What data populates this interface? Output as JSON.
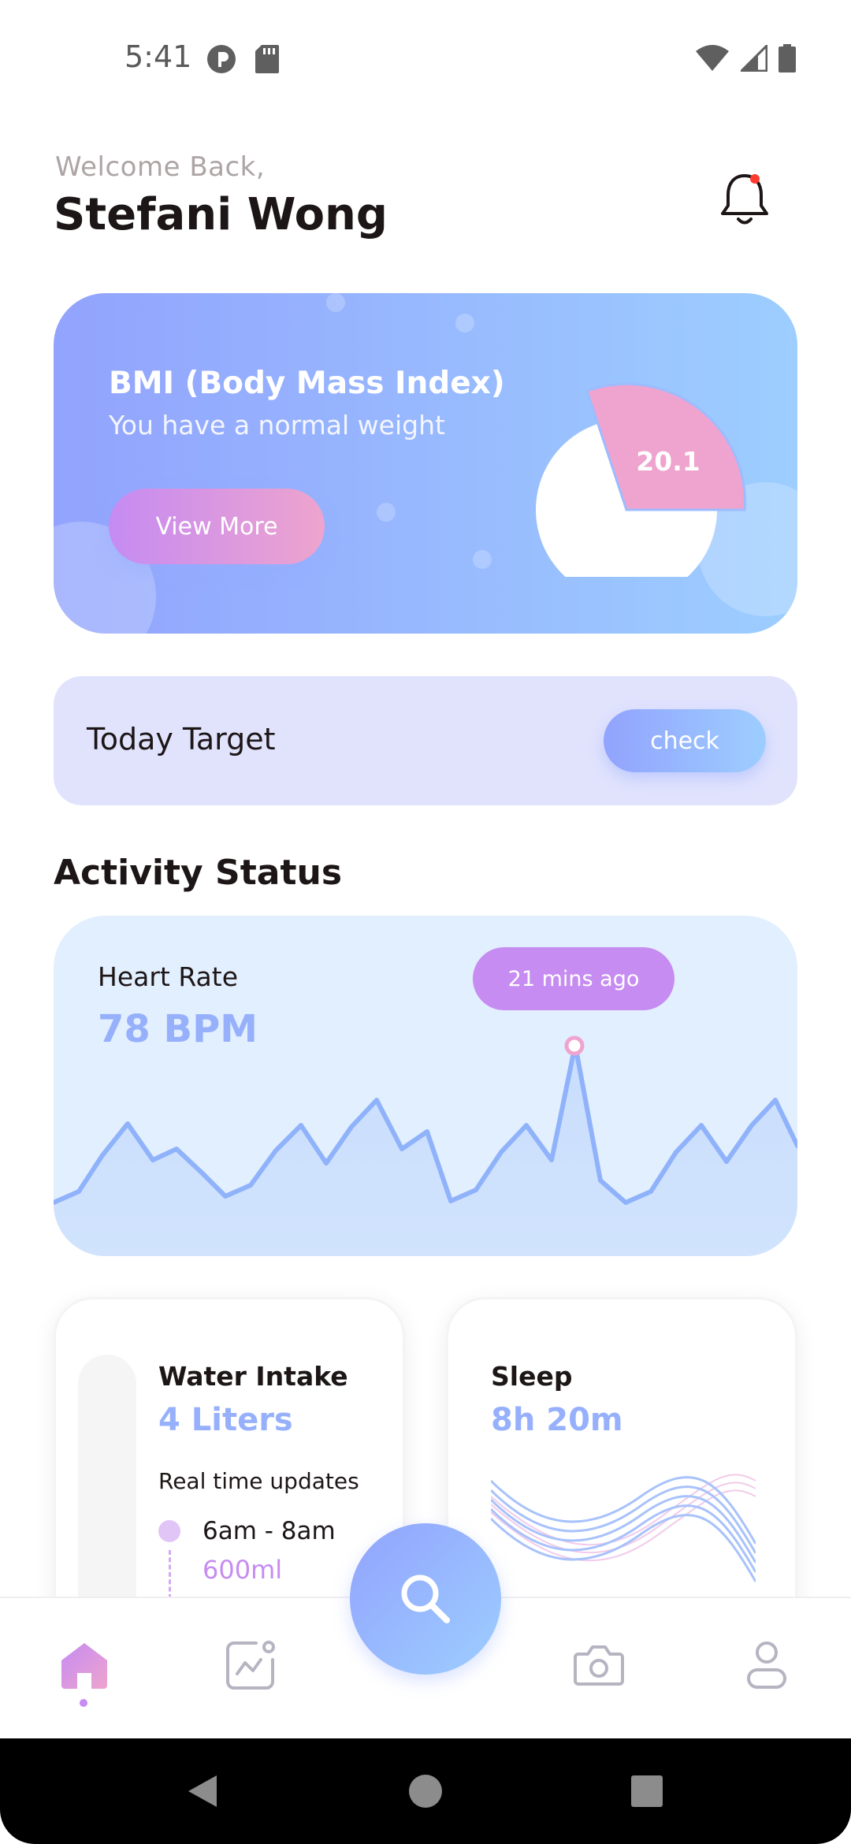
{
  "status_bar": {
    "time": "5:41",
    "left_icons": [
      "notification-app-icon",
      "sd-card-icon"
    ],
    "right_icons": [
      "wifi-icon",
      "cell-signal-icon",
      "battery-icon"
    ]
  },
  "header": {
    "welcome": "Welcome Back,",
    "user_name": "Stefani Wong",
    "notification_icon": "bell-icon",
    "has_unread": true
  },
  "bmi_card": {
    "title": "BMI (Body Mass Index)",
    "subtitle": "You have a normal weight",
    "button_label": "View More",
    "value": "20.1"
  },
  "today_target": {
    "label": "Today Target",
    "button_label": "check"
  },
  "activity": {
    "section_title": "Activity Status",
    "heart_rate": {
      "label": "Heart Rate",
      "value": "78 BPM",
      "badge": "21 mins ago"
    },
    "water": {
      "title": "Water Intake",
      "value": "4 Liters",
      "updates_label": "Real time updates",
      "entries": [
        {
          "time": "6am - 8am",
          "amount": "600ml"
        }
      ]
    },
    "sleep": {
      "title": "Sleep",
      "value": "8h 20m"
    }
  },
  "bottom_nav": {
    "items": [
      "home-icon",
      "activity-icon",
      "search-icon",
      "camera-icon",
      "profile-icon"
    ],
    "active": "home-icon"
  },
  "colors": {
    "brand_blue": "#92a3fd",
    "brand_light_blue": "#9dceff",
    "brand_purple": "#c58bf2",
    "brand_pink": "#eea4ce",
    "text_dark": "#1d1617",
    "text_gray": "#ada4a5"
  }
}
